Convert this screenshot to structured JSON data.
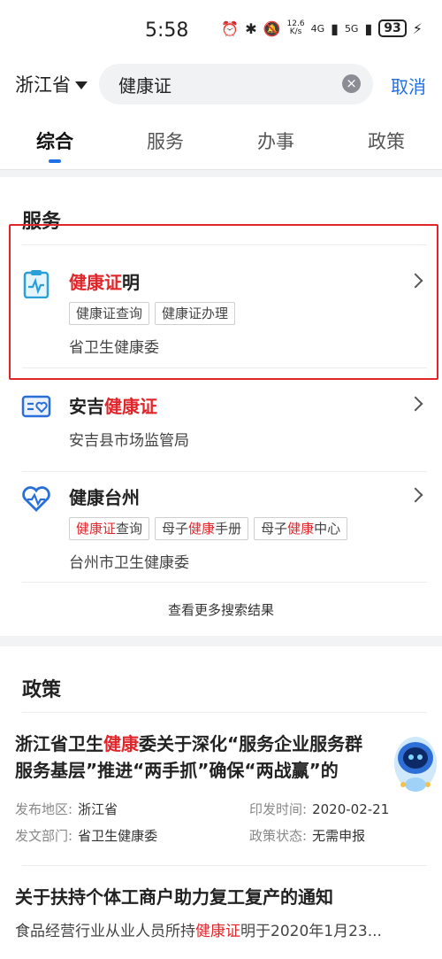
{
  "status": {
    "time": "5:58",
    "net_speed_value": "12.6",
    "net_speed_unit": "K/s",
    "signal_1": "4G",
    "signal_2": "5G",
    "battery": "93"
  },
  "search": {
    "region": "浙江省",
    "query": "健康证",
    "cancel": "取消"
  },
  "tabs": [
    "综合",
    "服务",
    "办事",
    "政策"
  ],
  "services": {
    "section_title": "服务",
    "items": [
      {
        "title_hl": "健康证",
        "title_rest": "明",
        "tags": [
          {
            "pre": "",
            "hl": "",
            "post": "健康证查询"
          },
          {
            "pre": "",
            "hl": "",
            "post": "健康证办理"
          }
        ],
        "dept": "省卫生健康委"
      },
      {
        "title_pre": "安吉",
        "title_hl": "健康证",
        "dept": "安吉县市场监管局"
      },
      {
        "title": "健康台州",
        "tags": [
          {
            "pre": "",
            "hl": "健康证",
            "post": "查询"
          },
          {
            "pre": "母子",
            "hl": "健康",
            "post": "手册"
          },
          {
            "pre": "母子",
            "hl": "健康",
            "post": "中心"
          }
        ],
        "dept": "台州市卫生健康委"
      }
    ],
    "more": "查看更多搜索结果"
  },
  "policy": {
    "section_title": "政策",
    "items": [
      {
        "title_line1_pre": "浙江省卫生",
        "title_line1_hl": "健康",
        "title_line1_post": "委关于深化“服务企业服务群",
        "title_line2": "服务基层”推进“两手抓”确保“两战赢”的",
        "region_label": "发布地区:",
        "region": "浙江省",
        "date_label": "印发时间:",
        "date": "2020-02-21",
        "dept_label": "发文部门:",
        "dept": "省卫生健康委",
        "status_label": "政策状态:",
        "status": "无需申报"
      },
      {
        "title": "关于扶持个体工商户助力复工复产的通知",
        "desc_pre": "食品经营行业从业人员所持",
        "desc_hl": "健康证",
        "desc_post": "明于2020年1月23..."
      }
    ]
  },
  "colors": {
    "accent": "#1f6fe5",
    "highlight": "#e0262b",
    "annotation_box": "#e0262b"
  }
}
